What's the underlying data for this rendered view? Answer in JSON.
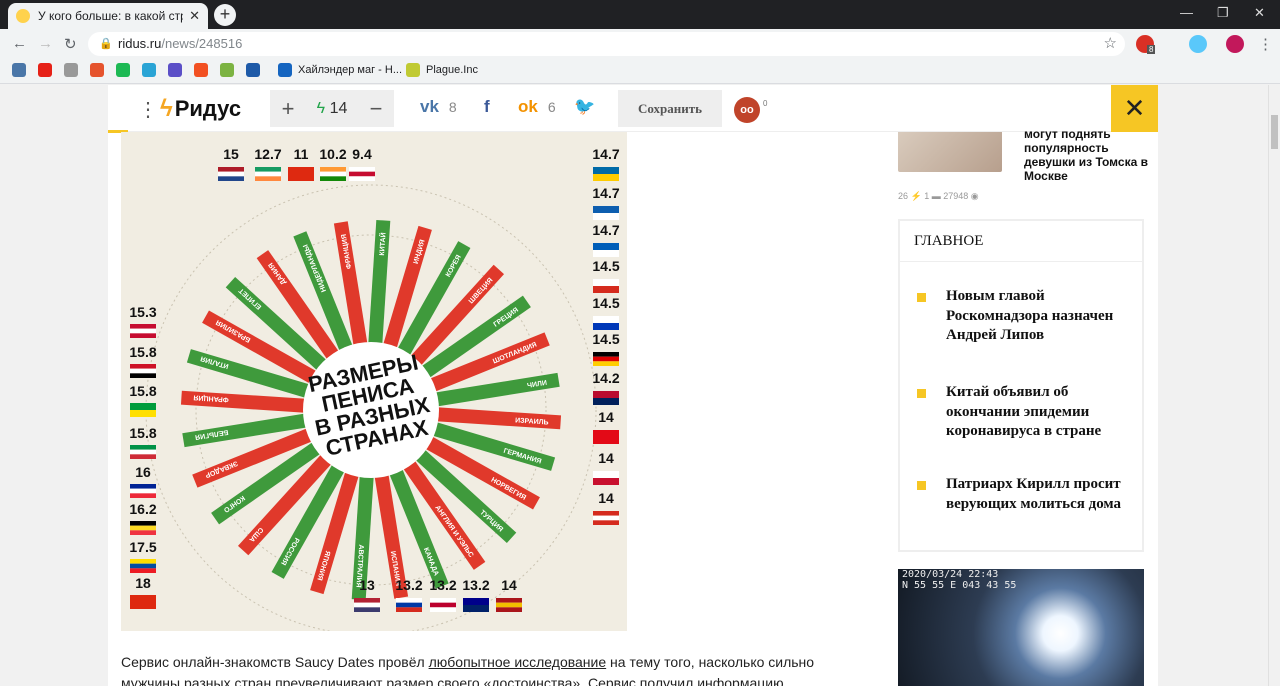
{
  "browser": {
    "tab_title": "У кого больше: в какой стране",
    "url_domain": "ridus.ru",
    "url_path": "/news/248516",
    "bookmarks": [
      "Хайлэндер маг - Н...",
      "Plague.Inc"
    ],
    "ext_badge": "8"
  },
  "site": {
    "logo": "Ридус",
    "vote_count": "14",
    "share_vk": "8",
    "share_ok": "6",
    "save_label": "Сохранить",
    "glasses_count": "0"
  },
  "infographic": {
    "title_lines": [
      "РАЗМЕРЫ",
      "ПЕНИСА",
      "В РАЗНЫХ",
      "СТРАНАХ"
    ],
    "colors": {
      "red": "#e0392b",
      "green": "#3f9a3c",
      "bg": "#f1ede2"
    }
  },
  "chart_data": {
    "type": "bar",
    "categories": [
      "Нидерланды",
      "Франция",
      "Китай",
      "Индия",
      "Корея",
      "Швеция",
      "Греция",
      "Шотландия",
      "Чили",
      "Израиль",
      "Германия",
      "Норвегия",
      "Турция",
      "Англия и Уэльс",
      "Канада",
      "Испания",
      "Австралия",
      "Япония",
      "Россия",
      "США",
      "Конго",
      "Эквадор",
      "Бельгия",
      "Франция",
      "Италия",
      "Бразилия",
      "Египет",
      "Дания"
    ],
    "top_values": [
      "15",
      "12.7",
      "11",
      "10.2",
      "9.4"
    ],
    "right_values": [
      "14.7",
      "14.7",
      "14.7",
      "14.5",
      "14.5",
      "14.5",
      "14.2",
      "14",
      "14",
      "14"
    ],
    "bottom_values": [
      "13",
      "13.2",
      "13.2",
      "13.2",
      "14"
    ],
    "left_values": [
      "15.3",
      "15.8",
      "15.8",
      "15.8",
      "16",
      "16.2",
      "17.5",
      "18"
    ]
  },
  "article": {
    "text_before": "Сервис онлайн-знакомств Saucy Dates провёл ",
    "link": "любопытное исследование",
    "text_after": " на тему того, насколько сильно",
    "line2": "мужчины разных стран преувеличивают размер своего «достоинства». Сервис получил информацию"
  },
  "sidebar": {
    "news_title": "могут поднять популярность девушки из Томска в Москве",
    "news_meta": "26 ⚡ 1 ▬ 27948 ◉",
    "main_header": "ГЛАВНОЕ",
    "main_items": [
      "Новым главой Роскомнадзора назначен Андрей Липов",
      "Китай объявил об окончании эпидемии коронавируса в стране",
      "Патриарх Кирилл просит верующих молиться дома"
    ],
    "video_osd_1": "2020/03/24 22:43",
    "video_osd_2": "N 55 55 E 043 43 55"
  }
}
